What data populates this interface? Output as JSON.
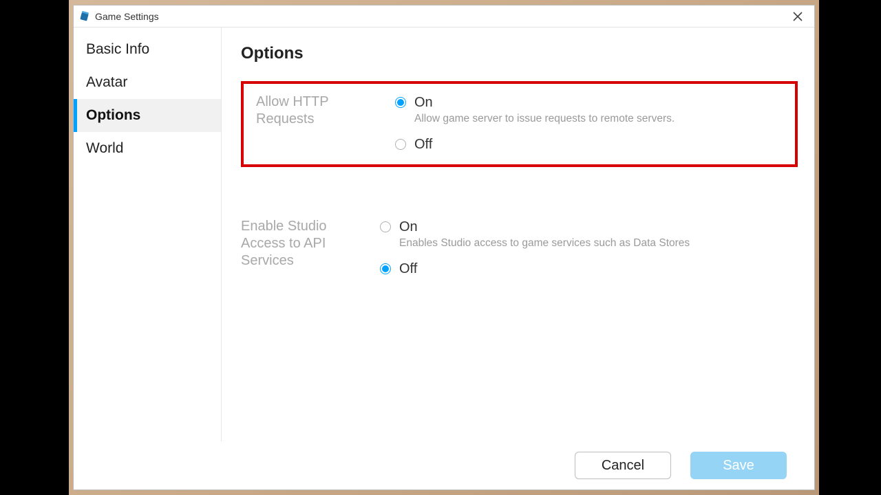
{
  "window": {
    "title": "Game Settings"
  },
  "sidebar": {
    "items": [
      {
        "label": "Basic Info"
      },
      {
        "label": "Avatar"
      },
      {
        "label": "Options"
      },
      {
        "label": "World"
      }
    ]
  },
  "content": {
    "title": "Options",
    "settings": [
      {
        "label": "Allow HTTP Requests",
        "options": {
          "on": "On",
          "onDesc": "Allow game server to issue requests to remote servers.",
          "off": "Off"
        },
        "selected": "on"
      },
      {
        "label": "Enable Studio Access to API Services",
        "options": {
          "on": "On",
          "onDesc": "Enables Studio access to game services such as Data Stores",
          "off": "Off"
        },
        "selected": "off"
      }
    ]
  },
  "footer": {
    "cancel": "Cancel",
    "save": "Save"
  }
}
